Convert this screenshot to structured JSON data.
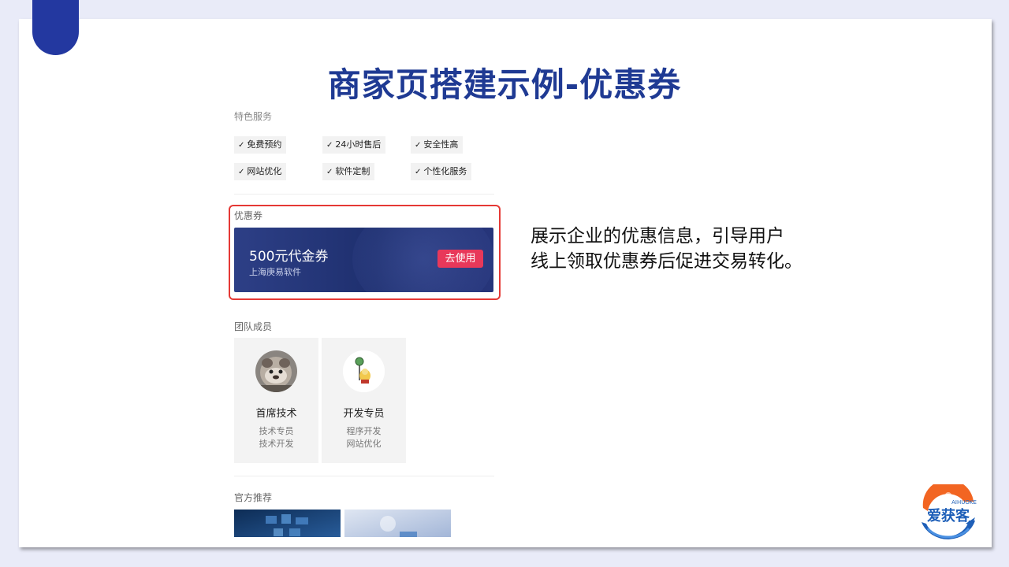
{
  "slide": {
    "title": "商家页搭建示例-优惠券",
    "description_line1": "展示企业的优惠信息，引导用户",
    "description_line2": "线上领取优惠券后促进交易转化。"
  },
  "phone": {
    "services_label": "特色服务",
    "services": [
      "免费预约",
      "24小时售后",
      "安全性高",
      "网站优化",
      "软件定制",
      "个性化服务"
    ],
    "coupon_section_label": "优惠券",
    "coupon": {
      "name": "500元代金券",
      "company": "上海庚易软件",
      "button": "去使用"
    },
    "team_label": "团队成员",
    "members": [
      {
        "name": "首席技术",
        "line1": "技术专员",
        "line2": "技术开发"
      },
      {
        "name": "开发专员",
        "line1": "程序开发",
        "line2": "网站优化"
      }
    ],
    "recommend_label": "官方推荐"
  },
  "logo": {
    "text": "爱获客",
    "sub": "AIHUOKE"
  },
  "colors": {
    "title": "#1f3a93",
    "accent_tab": "#2338a0",
    "highlight_border": "#e53935",
    "coupon_button": "#e8385a"
  }
}
